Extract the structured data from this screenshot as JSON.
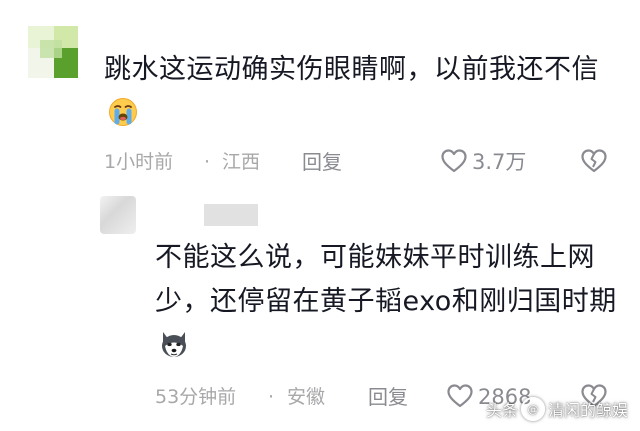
{
  "comments": [
    {
      "text": "跳水这运动确实伤眼睛啊，以前我还不信",
      "emoji": "loudly-crying-face-icon",
      "time": "1小时前",
      "separator": "·",
      "location": "江西",
      "reply_label": "回复",
      "like_count": "3.7万"
    },
    {
      "text": "不能这么说，可能妹妹平时训练上网少，还停留在黄子韬exo和刚归国时期",
      "emoji": "husky-dog-face-icon",
      "time": "53分钟前",
      "separator": "·",
      "location": "安徽",
      "reply_label": "回复",
      "like_count": "2868"
    }
  ],
  "watermark": {
    "brand": "头条",
    "at": "@",
    "account": "清闲的鲸娱"
  },
  "colors": {
    "text": "#161823",
    "meta": "#a8a8ab",
    "avatar_green": "#5aa02c"
  }
}
